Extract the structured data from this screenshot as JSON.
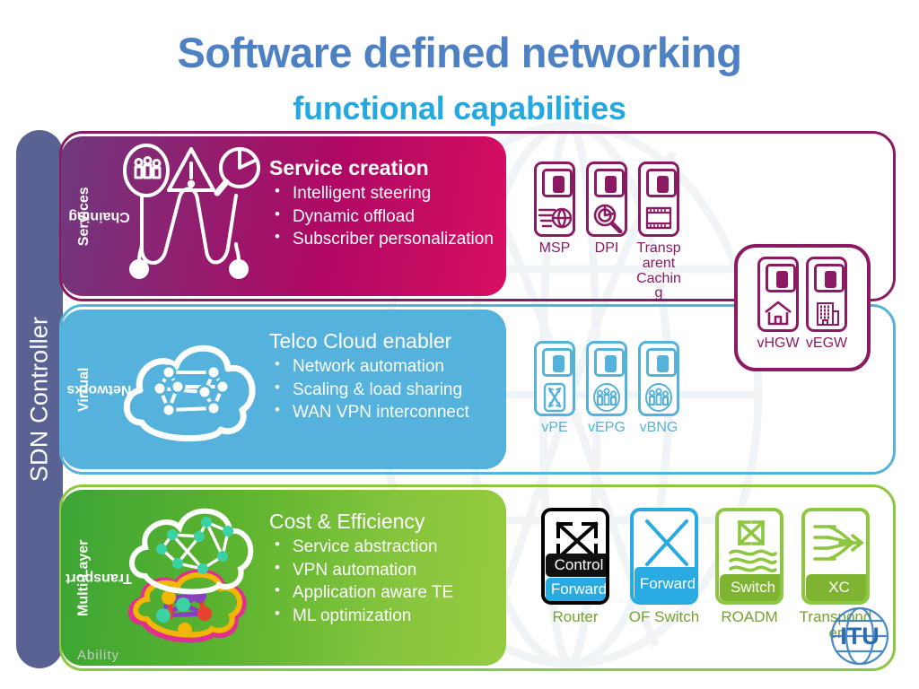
{
  "title": {
    "main": "Software defined networking",
    "sub": "functional capabilities",
    "main_color": "#4E81C4",
    "sub_color": "#23A8E0"
  },
  "sidebar": {
    "label": "SDN Controller",
    "color": "#5A6293"
  },
  "ghost_text": "Ability",
  "rows": [
    {
      "id": "services-chaining",
      "vlabel_line1": "Services",
      "vlabel_line2": "Chaining",
      "heading": "Service creation",
      "bullets": [
        "Intelligent steering",
        "Dynamic offload",
        "Subscriber personalization"
      ],
      "accent": "#8B1A62",
      "pictogram": "service-chain-icon",
      "devices": [
        {
          "label": "MSP",
          "glyph": "globe-document-icon"
        },
        {
          "label": "DPI",
          "glyph": "magnifier-pie-icon"
        },
        {
          "label": "Transparent Caching",
          "glyph": "film-strip-icon"
        }
      ],
      "capsule": {
        "devices": [
          {
            "label": "vHGW",
            "glyph": "house-icon"
          },
          {
            "label": "vEGW",
            "glyph": "office-building-icon"
          }
        ]
      }
    },
    {
      "id": "virtual-networks",
      "vlabel_line1": "Virtual",
      "vlabel_line2": "Networks",
      "heading": "Telco Cloud enabler",
      "bullets": [
        "Network automation",
        "Scaling & load sharing",
        "WAN VPN interconnect"
      ],
      "accent": "#55B2DB",
      "pictogram": "cloud-mesh-icon",
      "devices": [
        {
          "label": "vPE",
          "glyph": "crossconnect-icon"
        },
        {
          "label": "vEPG",
          "glyph": "users-group-icon"
        },
        {
          "label": "vBNG",
          "glyph": "users-group-icon"
        }
      ]
    },
    {
      "id": "multi-layer-transport",
      "vlabel_line1": "Multi-Layer",
      "vlabel_line2": "Transport",
      "heading": "Cost & Efficiency",
      "bullets": [
        "Service abstraction",
        "VPN automation",
        "Application aware TE",
        "ML optimization"
      ],
      "accent": "#8DC63F",
      "pictogram": "multilayer-cloud-icon",
      "transport_devices": [
        {
          "label": "Router",
          "glyph": "x-arrows-icon",
          "pills": [
            {
              "text": "Control",
              "bg": "#111111"
            },
            {
              "text": "Forward",
              "bg": "#29ABE2"
            }
          ],
          "border": "#000000",
          "label_color": "#76A22E"
        },
        {
          "label": "OF Switch",
          "glyph": "x-lines-icon",
          "pills": [
            {
              "text": "Forward",
              "bg": "#29ABE2"
            }
          ],
          "border": "#29ABE2",
          "label_color": "#76A22E"
        },
        {
          "label": "ROADM",
          "glyph": "wave-arrows-icon",
          "pills": [
            {
              "text": "Switch",
              "bg": "#7FB432"
            }
          ],
          "border": "#8DC63F",
          "label_color": "#76A22E"
        },
        {
          "label": "Transponder",
          "glyph": "converge-arrow-icon",
          "pills": [
            {
              "text": "XC",
              "bg": "#7FB432"
            }
          ],
          "border": "#8DC63F",
          "label_color": "#76A22E"
        }
      ]
    }
  ],
  "logo": {
    "name": "itu-logo",
    "text": "ITU"
  }
}
